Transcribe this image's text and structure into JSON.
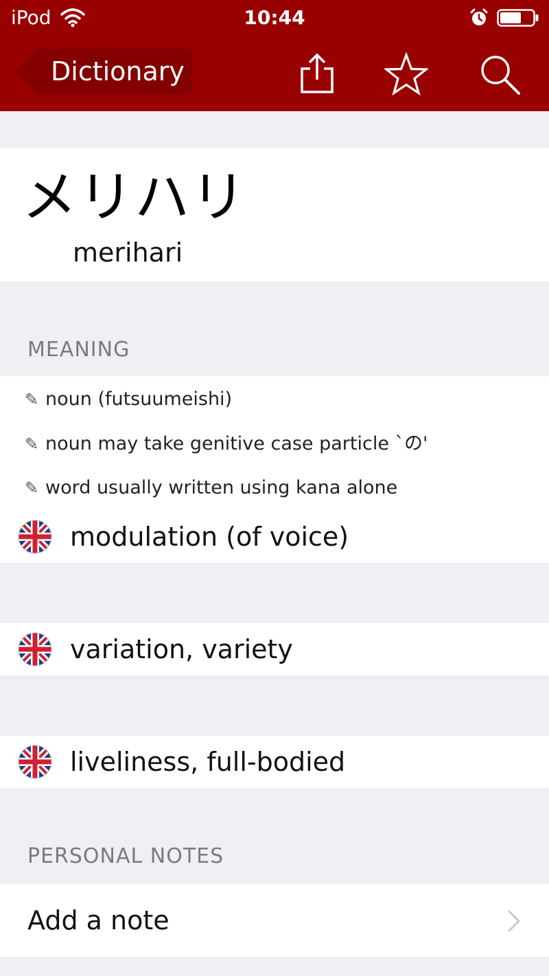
{
  "status_bar": {
    "carrier": "iPod",
    "time": "10:44"
  },
  "nav": {
    "back_label": "Dictionary",
    "icons": [
      "share-icon",
      "star-icon",
      "search-icon"
    ]
  },
  "entry": {
    "kana": "メリハリ",
    "romaji": "merihari"
  },
  "meaning": {
    "header": "MEANING",
    "tags": [
      "noun (futsuumeishi)",
      "noun may take genitive case particle `の'",
      "word usually written using kana alone"
    ],
    "definitions": [
      "modulation (of voice)",
      "variation, variety",
      "liveliness, full-bodied"
    ]
  },
  "notes": {
    "header": "PERSONAL NOTES",
    "add_label": "Add a note"
  },
  "colors": {
    "header_bg": "#990000",
    "page_bg": "#efeff4",
    "section_text": "#7a7a80"
  }
}
